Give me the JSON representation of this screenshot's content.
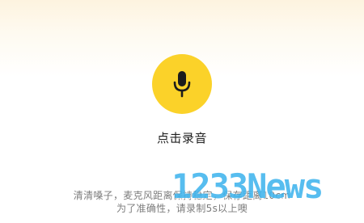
{
  "record": {
    "label": "点击录音",
    "icon": "microphone-icon",
    "button_color": "#fbd229"
  },
  "instructions": {
    "line1": "清清嗓子，麦克风距离保持稳定，保存距离10cm",
    "line2": "为了准确性，请录制5s以上噢"
  },
  "watermark": {
    "text": "1233News"
  }
}
